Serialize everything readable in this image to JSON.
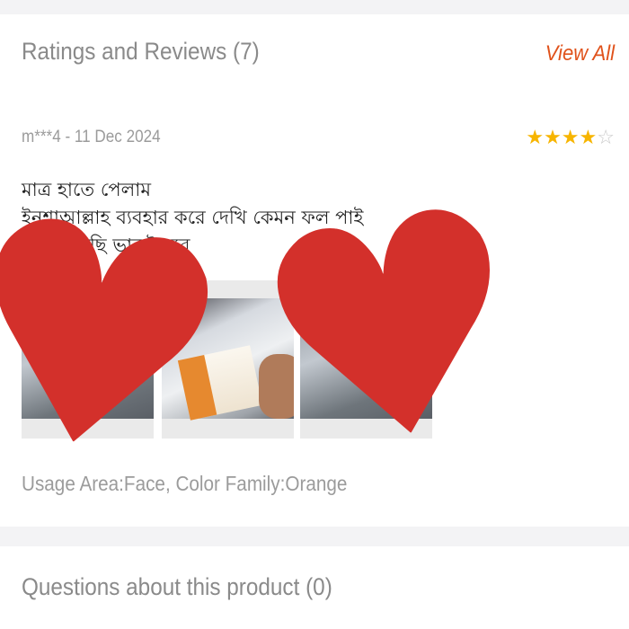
{
  "reviews_section": {
    "title": "Ratings and Reviews (7)",
    "view_all_label": "View All",
    "accent_color": "#e0521b",
    "review": {
      "reviewer": "m***4",
      "date": "11 Dec 2024",
      "meta": "m***4 - 11 Dec 2024",
      "rating": 4,
      "rating_max": 5,
      "star_filled_glyph": "★",
      "star_empty_glyph": "☆",
      "star_color": "#f7b500",
      "body_lines": [
        "মাত্র হাতে পেলাম",
        "ইনশাআল্লাহ ব্যবহার করে দেখি কেমন ফল পাই",
        "আশা করছি ভালই হবে"
      ],
      "images": [
        {
          "icon": "review-photo-1"
        },
        {
          "icon": "review-photo-2"
        },
        {
          "icon": "review-photo-3"
        }
      ],
      "variant": "Usage Area:Face, Color Family:Orange"
    }
  },
  "overlay": {
    "heart_glyph": "♥",
    "heart_color": "#d3302b"
  },
  "questions_section": {
    "title": "Questions about this product (0)"
  }
}
